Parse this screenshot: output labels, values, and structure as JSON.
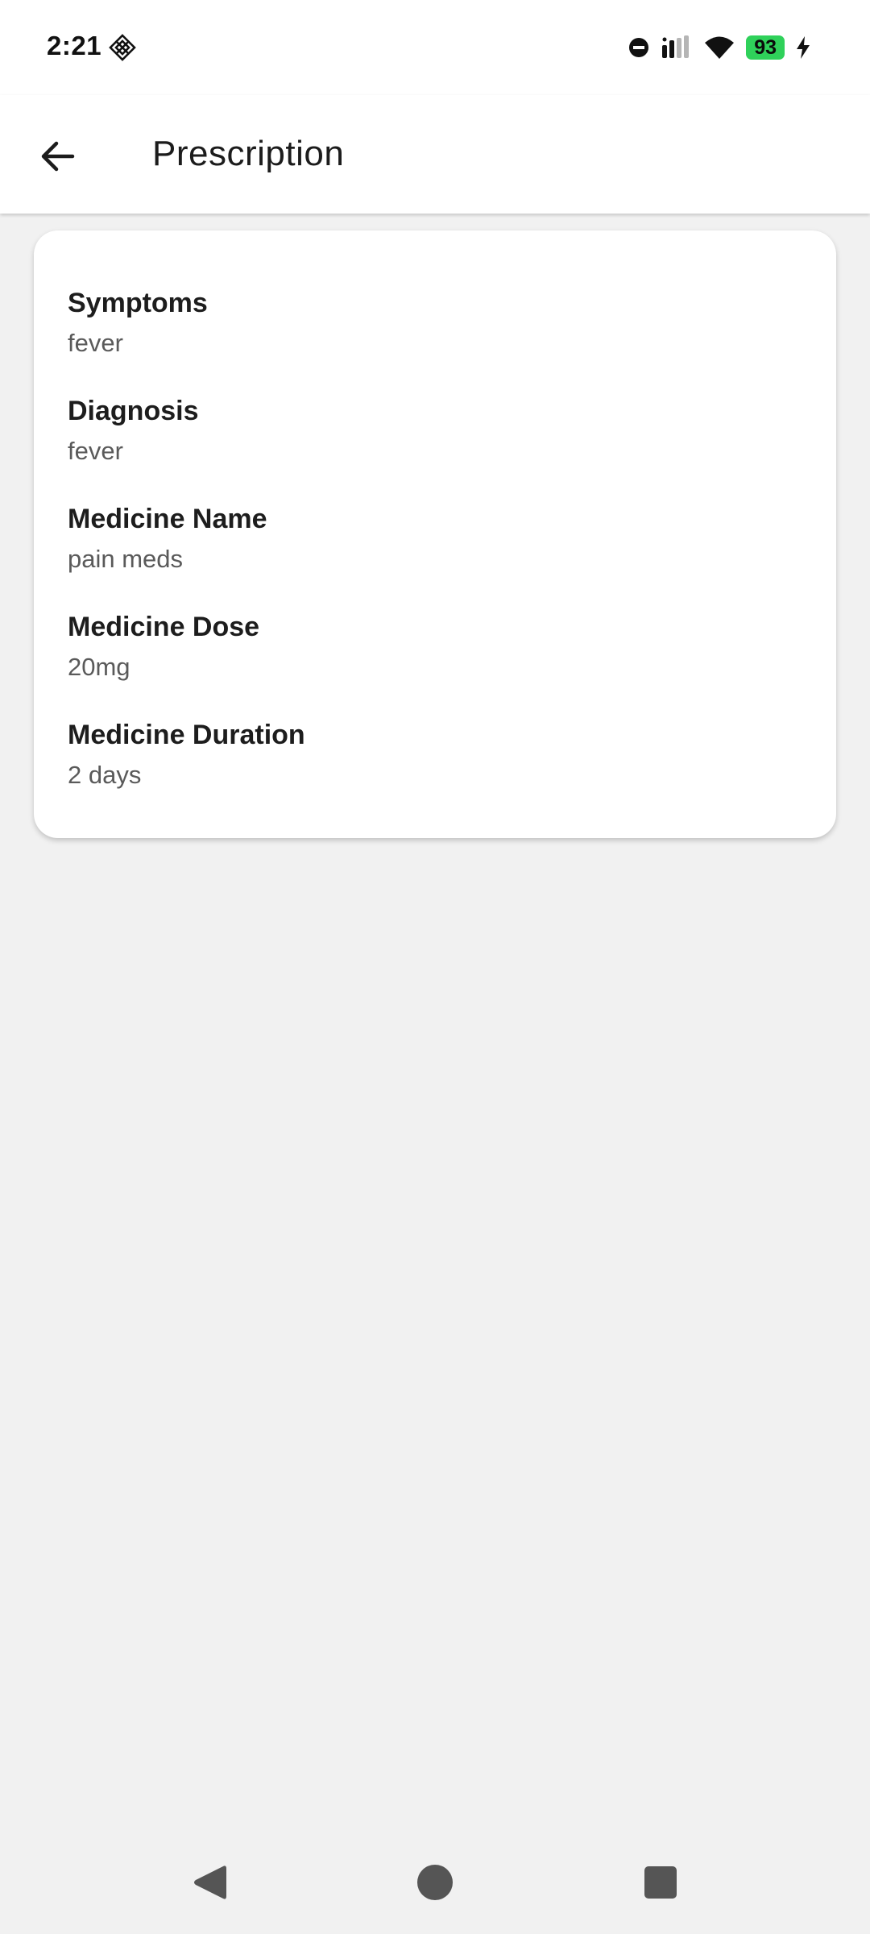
{
  "status_bar": {
    "time": "2:21",
    "battery_level": "93",
    "battery_color": "#2fd15a",
    "icons": [
      "app-notification-icon",
      "dnd-icon",
      "signal-icon",
      "wifi-icon",
      "battery-icon",
      "charging-icon"
    ]
  },
  "app_bar": {
    "title": "Prescription",
    "back_icon": "arrow-back-icon"
  },
  "prescription": {
    "fields": [
      {
        "label": "Symptoms",
        "value": "fever"
      },
      {
        "label": "Diagnosis",
        "value": "fever"
      },
      {
        "label": "Medicine Name",
        "value": "pain meds"
      },
      {
        "label": "Medicine Dose",
        "value": "20mg"
      },
      {
        "label": "Medicine Duration",
        "value": "2 days"
      }
    ]
  },
  "nav_bar": {
    "buttons": [
      "back-triangle-icon",
      "home-circle-icon",
      "recents-square-icon"
    ]
  }
}
